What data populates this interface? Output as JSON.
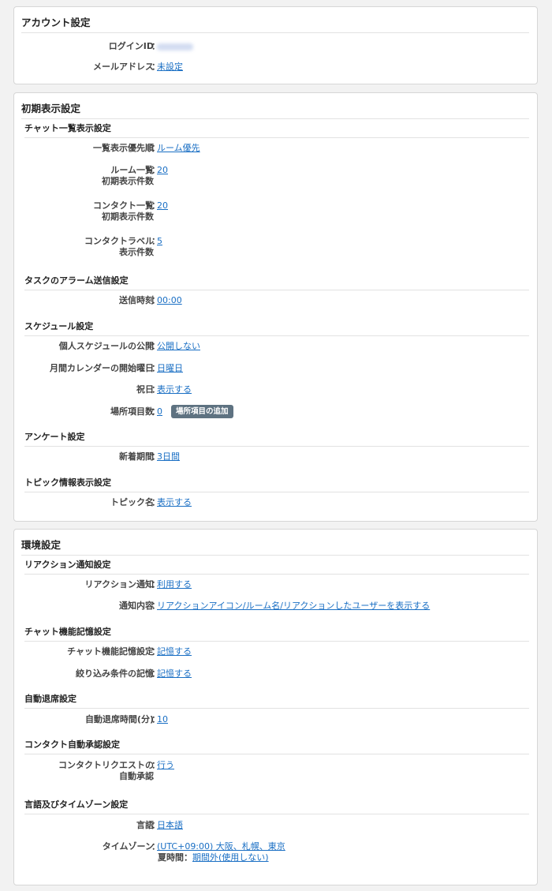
{
  "account": {
    "title": "アカウント設定",
    "login_label": "ログインID",
    "email_label": "メールアドレス",
    "email_value": "未設定"
  },
  "initial": {
    "title": "初期表示設定",
    "chat": {
      "title": "チャット一覧表示設定",
      "priority_label": "一覧表示優先順",
      "priority_value": "ルーム優先",
      "room_label1": "ルーム一覧",
      "room_label2": "初期表示件数",
      "room_value": "20",
      "contact_label1": "コンタクト一覧",
      "contact_label2": "初期表示件数",
      "contact_value": "20",
      "label_label1": "コンタクトラベル",
      "label_label2": "表示件数",
      "label_value": "5"
    },
    "alarm": {
      "title": "タスクのアラーム送信設定",
      "time_label": "送信時刻",
      "time_value": "00:00"
    },
    "schedule": {
      "title": "スケジュール設定",
      "public_label": "個人スケジュールの公開",
      "public_value": "公開しない",
      "startday_label": "月間カレンダーの開始曜日",
      "startday_value": "日曜日",
      "holiday_label": "祝日",
      "holiday_value": "表示する",
      "place_label": "場所項目数",
      "place_value": "0",
      "place_button": "場所項目の追加"
    },
    "survey": {
      "title": "アンケート設定",
      "new_label": "新着期間",
      "new_value": "3日間"
    },
    "topic": {
      "title": "トピック情報表示設定",
      "name_label": "トピック名",
      "name_value": "表示する"
    }
  },
  "env": {
    "title": "環境設定",
    "reaction": {
      "title": "リアクション通知設定",
      "notify_label": "リアクション通知",
      "notify_value": "利用する",
      "content_label": "通知内容",
      "content_value": "リアクションアイコン/ルーム名/リアクションしたユーザーを表示する"
    },
    "memory": {
      "title": "チャット機能記憶設定",
      "chat_label": "チャット機能記憶設定",
      "chat_value": "記憶する",
      "filter_label": "絞り込み条件の記憶",
      "filter_value": "記憶する"
    },
    "autoleave": {
      "title": "自動退席設定",
      "time_label": "自動退席時間(分)",
      "time_value": "10"
    },
    "contact": {
      "title": "コンタクト自動承認設定",
      "req_label1": "コンタクトリクエストの",
      "req_label2": "自動承認",
      "req_value": "行う"
    },
    "locale": {
      "title": "言語及びタイムゾーン設定",
      "lang_label": "言語",
      "lang_value": "日本語",
      "tz_label": "タイムゾーン",
      "tz_value": "(UTC+09:00) 大阪、札幌、東京",
      "dst_label": "夏時間",
      "dst_value": "期間外(使用しない)"
    }
  },
  "colon": "："
}
